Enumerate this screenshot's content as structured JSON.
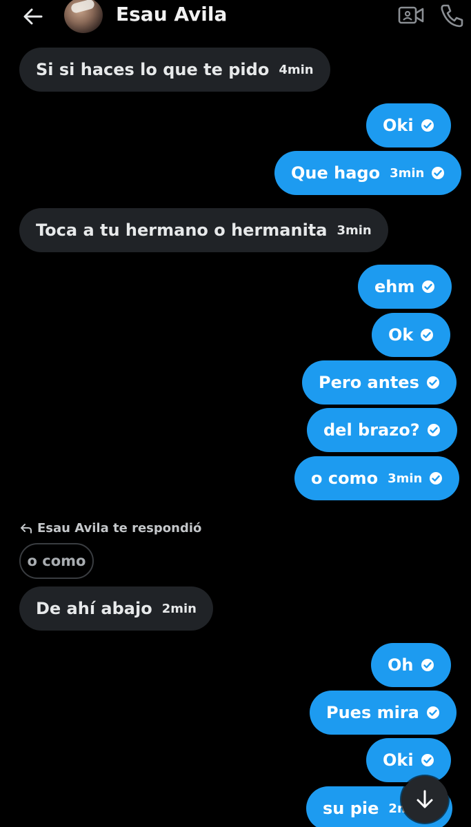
{
  "header": {
    "title": "Esau Avila",
    "icons": [
      "back-arrow-icon",
      "avatar",
      "video-call-icon",
      "phone-call-icon"
    ]
  },
  "messages": [
    {
      "dir": "in",
      "text": "Si si haces lo que te pido",
      "time": "4min"
    },
    {
      "dir": "out",
      "text": "Oki",
      "time": ""
    },
    {
      "dir": "out",
      "text": "Que hago",
      "time": "3min"
    },
    {
      "dir": "in",
      "text": "Toca a tu hermano o hermanita",
      "time": "3min"
    },
    {
      "dir": "out",
      "text": "ehm",
      "time": ""
    },
    {
      "dir": "out",
      "text": "Ok",
      "time": ""
    },
    {
      "dir": "out",
      "text": "Pero antes",
      "time": ""
    },
    {
      "dir": "out",
      "text": "del brazo?",
      "time": ""
    },
    {
      "dir": "out",
      "text": "o como",
      "time": "3min"
    },
    {
      "dir": "in",
      "text": "De ahí abajo",
      "time": "2min"
    },
    {
      "dir": "out",
      "text": "Oh",
      "time": ""
    },
    {
      "dir": "out",
      "text": "Pues mira",
      "time": ""
    },
    {
      "dir": "out",
      "text": "Oki",
      "time": ""
    },
    {
      "dir": "out",
      "text": "su pie",
      "time": "2m"
    }
  ],
  "reply": {
    "label": "Esau Avila te respondió",
    "quoted": "o como"
  },
  "colors": {
    "background": "#000000",
    "incoming_bubble": "#202327",
    "outgoing_bubble": "#1d9bf0"
  }
}
